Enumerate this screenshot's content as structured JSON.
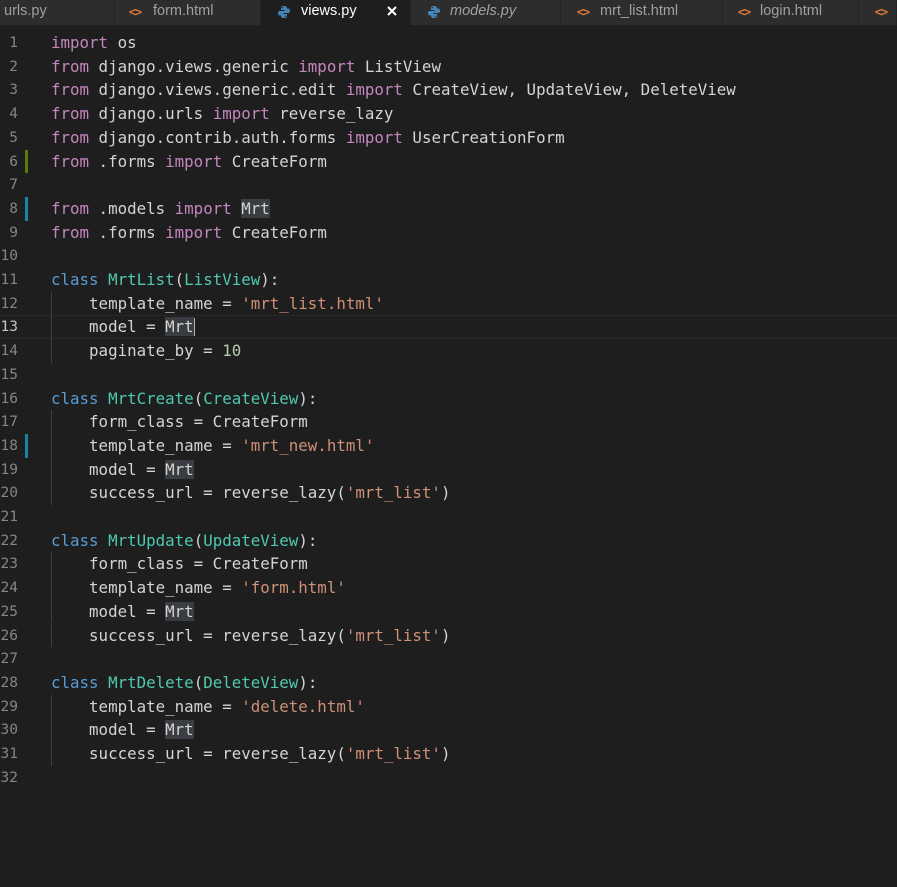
{
  "tabs": [
    {
      "label": "urls.py",
      "icon": "python-icon",
      "active": false,
      "italic": false
    },
    {
      "label": "form.html",
      "icon": "html-icon",
      "active": false,
      "italic": false
    },
    {
      "label": "views.py",
      "icon": "python-icon",
      "active": true,
      "italic": false,
      "close_glyph": "✕"
    },
    {
      "label": "models.py",
      "icon": "python-icon",
      "active": false,
      "italic": true
    },
    {
      "label": "mrt_list.html",
      "icon": "html-icon",
      "active": false,
      "italic": false
    },
    {
      "label": "login.html",
      "icon": "html-icon",
      "active": false,
      "italic": false
    }
  ],
  "html_icon_glyph": "<>",
  "colors": {
    "keyword_import": "#c586c0",
    "keyword_class": "#569cd6",
    "class_name": "#4ec9b0",
    "string": "#ce9178",
    "number": "#b5cea8",
    "git_modified": "#1b81a8",
    "git_added": "#587c0c",
    "python_icon": "#4584b6"
  },
  "editor": {
    "current_line": 13,
    "lines": [
      {
        "n": "1",
        "tokens": [
          [
            "kw-import",
            "import"
          ],
          [
            "plain",
            " os"
          ]
        ]
      },
      {
        "n": "2",
        "tokens": [
          [
            "kw-import",
            "from"
          ],
          [
            "plain",
            " django.views.generic "
          ],
          [
            "kw-import",
            "import"
          ],
          [
            "plain",
            " ListView"
          ]
        ]
      },
      {
        "n": "3",
        "tokens": [
          [
            "kw-import",
            "from"
          ],
          [
            "plain",
            " django.views.generic.edit "
          ],
          [
            "kw-import",
            "import"
          ],
          [
            "plain",
            " CreateView, UpdateView, DeleteView"
          ]
        ]
      },
      {
        "n": "4",
        "tokens": [
          [
            "kw-import",
            "from"
          ],
          [
            "plain",
            " django.urls "
          ],
          [
            "kw-import",
            "import"
          ],
          [
            "plain",
            " reverse_lazy"
          ]
        ]
      },
      {
        "n": "5",
        "tokens": [
          [
            "kw-import",
            "from"
          ],
          [
            "plain",
            " django.contrib.auth.forms "
          ],
          [
            "kw-import",
            "import"
          ],
          [
            "plain",
            " UserCreationForm"
          ]
        ]
      },
      {
        "n": "6",
        "git": "added",
        "tokens": [
          [
            "kw-import",
            "from"
          ],
          [
            "plain",
            " .forms "
          ],
          [
            "kw-import",
            "import"
          ],
          [
            "plain",
            " CreateForm"
          ]
        ]
      },
      {
        "n": "7",
        "tokens": []
      },
      {
        "n": "8",
        "git": "modified",
        "tokens": [
          [
            "kw-import",
            "from"
          ],
          [
            "plain",
            " .models "
          ],
          [
            "kw-import",
            "import"
          ],
          [
            "plain",
            " "
          ],
          [
            "plain hl",
            "Mrt"
          ]
        ]
      },
      {
        "n": "9",
        "tokens": [
          [
            "kw-import",
            "from"
          ],
          [
            "plain",
            " .forms "
          ],
          [
            "kw-import",
            "import"
          ],
          [
            "plain",
            " CreateForm"
          ]
        ]
      },
      {
        "n": "10",
        "tokens": []
      },
      {
        "n": "11",
        "tokens": [
          [
            "kw-class",
            "class"
          ],
          [
            "plain",
            " "
          ],
          [
            "cls",
            "MrtList"
          ],
          [
            "plain",
            "("
          ],
          [
            "cls",
            "ListView"
          ],
          [
            "plain",
            "):"
          ]
        ]
      },
      {
        "n": "12",
        "guide": true,
        "tokens": [
          [
            "plain",
            "    template_name = "
          ],
          [
            "str",
            "'mrt_list.html'"
          ]
        ]
      },
      {
        "n": "13",
        "guide": true,
        "cursor": true,
        "tokens": [
          [
            "plain",
            "    model = "
          ],
          [
            "plain hl",
            "Mrt"
          ]
        ]
      },
      {
        "n": "14",
        "guide": true,
        "tokens": [
          [
            "plain",
            "    paginate_by = "
          ],
          [
            "num",
            "10"
          ]
        ]
      },
      {
        "n": "15",
        "tokens": []
      },
      {
        "n": "16",
        "tokens": [
          [
            "kw-class",
            "class"
          ],
          [
            "plain",
            " "
          ],
          [
            "cls",
            "MrtCreate"
          ],
          [
            "plain",
            "("
          ],
          [
            "cls",
            "CreateView"
          ],
          [
            "plain",
            "):"
          ]
        ]
      },
      {
        "n": "17",
        "guide": true,
        "tokens": [
          [
            "plain",
            "    form_class = CreateForm"
          ]
        ]
      },
      {
        "n": "18",
        "guide": true,
        "git": "modified",
        "tokens": [
          [
            "plain",
            "    template_name = "
          ],
          [
            "str",
            "'mrt_new.html'"
          ]
        ]
      },
      {
        "n": "19",
        "guide": true,
        "tokens": [
          [
            "plain",
            "    model = "
          ],
          [
            "plain hl",
            "Mrt"
          ]
        ]
      },
      {
        "n": "20",
        "guide": true,
        "tokens": [
          [
            "plain",
            "    success_url = reverse_lazy("
          ],
          [
            "str",
            "'mrt_list'"
          ],
          [
            "plain",
            ")"
          ]
        ]
      },
      {
        "n": "21",
        "tokens": []
      },
      {
        "n": "22",
        "tokens": [
          [
            "kw-class",
            "class"
          ],
          [
            "plain",
            " "
          ],
          [
            "cls",
            "MrtUpdate"
          ],
          [
            "plain",
            "("
          ],
          [
            "cls",
            "UpdateView"
          ],
          [
            "plain",
            "):"
          ]
        ]
      },
      {
        "n": "23",
        "guide": true,
        "tokens": [
          [
            "plain",
            "    form_class = CreateForm"
          ]
        ]
      },
      {
        "n": "24",
        "guide": true,
        "tokens": [
          [
            "plain",
            "    template_name = "
          ],
          [
            "str",
            "'form.html'"
          ]
        ]
      },
      {
        "n": "25",
        "guide": true,
        "tokens": [
          [
            "plain",
            "    model = "
          ],
          [
            "plain hl",
            "Mrt"
          ]
        ]
      },
      {
        "n": "26",
        "guide": true,
        "tokens": [
          [
            "plain",
            "    success_url = reverse_lazy("
          ],
          [
            "str",
            "'mrt_list'"
          ],
          [
            "plain",
            ")"
          ]
        ]
      },
      {
        "n": "27",
        "tokens": []
      },
      {
        "n": "28",
        "tokens": [
          [
            "kw-class",
            "class"
          ],
          [
            "plain",
            " "
          ],
          [
            "cls",
            "MrtDelete"
          ],
          [
            "plain",
            "("
          ],
          [
            "cls",
            "DeleteView"
          ],
          [
            "plain",
            "):"
          ]
        ]
      },
      {
        "n": "29",
        "guide": true,
        "tokens": [
          [
            "plain",
            "    template_name = "
          ],
          [
            "str",
            "'delete.html'"
          ]
        ]
      },
      {
        "n": "30",
        "guide": true,
        "tokens": [
          [
            "plain",
            "    model = "
          ],
          [
            "plain hl",
            "Mrt"
          ]
        ]
      },
      {
        "n": "31",
        "guide": true,
        "tokens": [
          [
            "plain",
            "    success_url = reverse_lazy("
          ],
          [
            "str",
            "'mrt_list'"
          ],
          [
            "plain",
            ")"
          ]
        ]
      },
      {
        "n": "32",
        "tokens": []
      }
    ]
  }
}
